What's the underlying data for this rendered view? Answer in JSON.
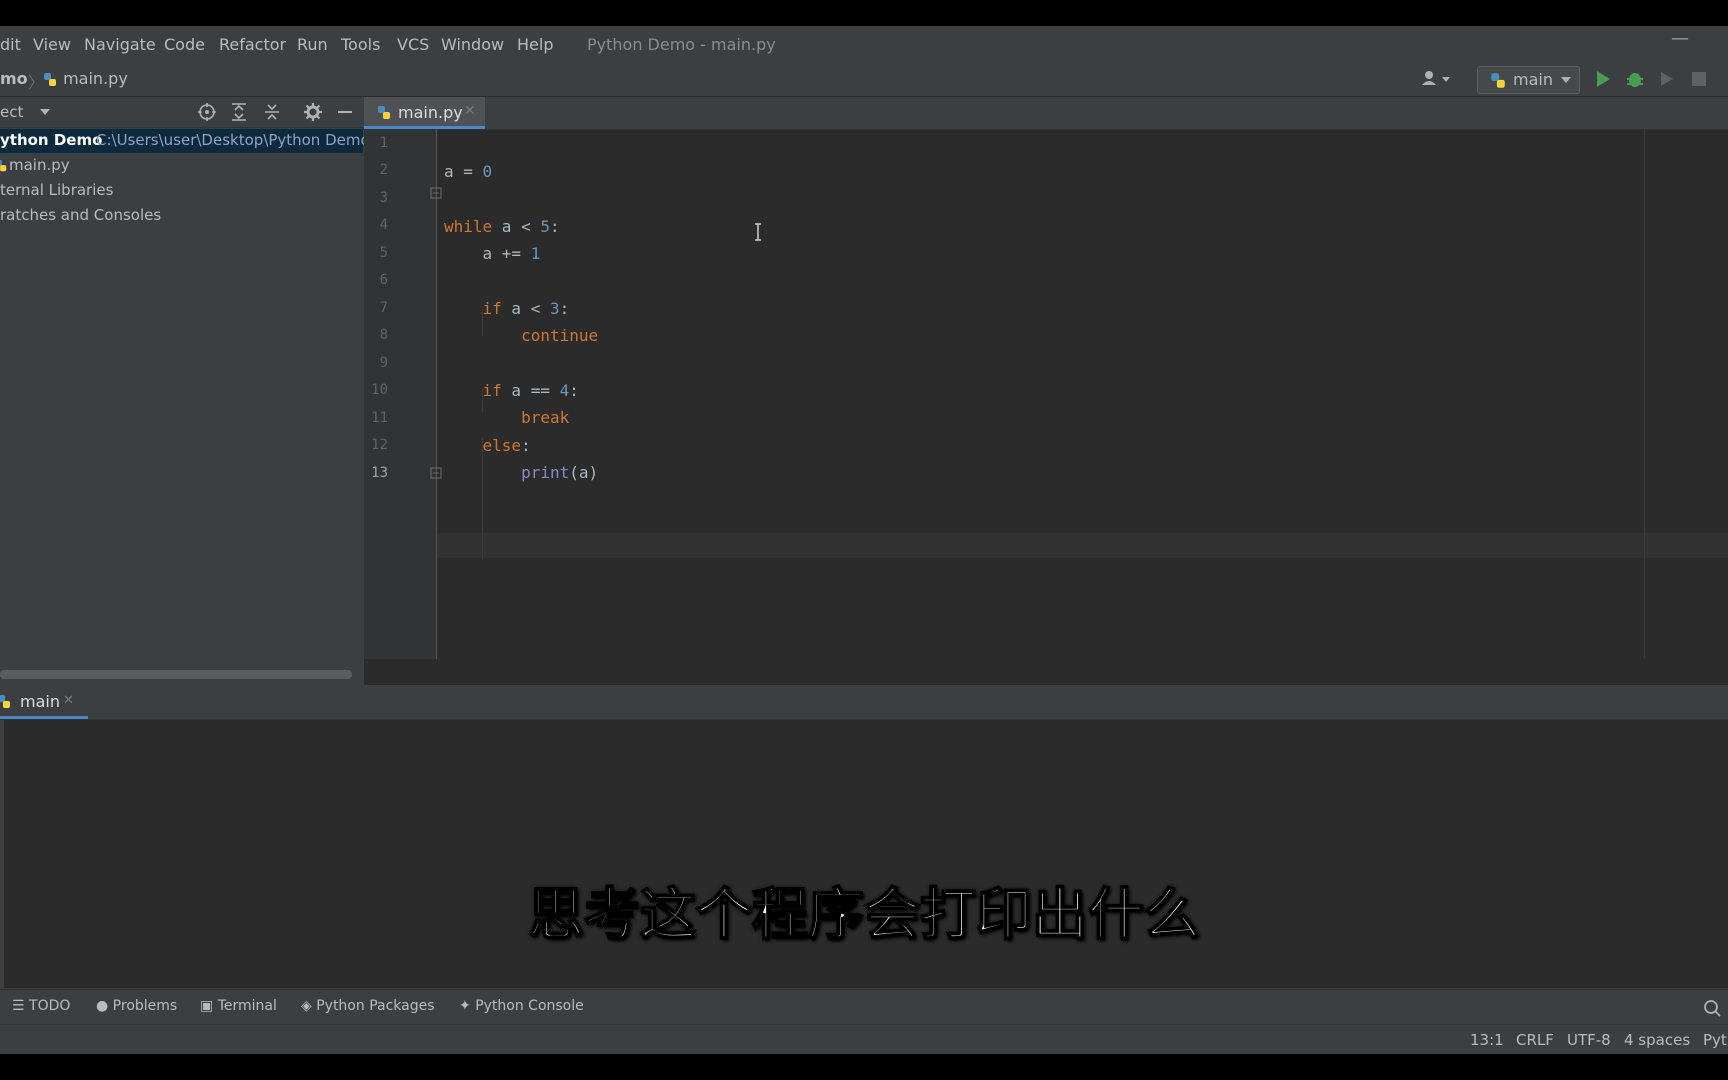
{
  "menubar": {
    "items": [
      "dit",
      "View",
      "Navigate",
      "Code",
      "Refactor",
      "Run",
      "Tools",
      "VCS",
      "Window",
      "Help"
    ],
    "window_title": "Python Demo - main.py"
  },
  "navbar": {
    "project_crumb": "mo",
    "file_crumb": "main.py",
    "run_config": "main"
  },
  "project_panel": {
    "header": "ect",
    "tree": [
      {
        "name": "ython Demo",
        "path": "C:\\Users\\user\\Desktop\\Python Demo"
      },
      {
        "name": "main.py"
      },
      {
        "name": "ternal Libraries"
      },
      {
        "name": "ratches and Consoles"
      }
    ]
  },
  "editor": {
    "tab": "main.py",
    "line_numbers": [
      "1",
      "2",
      "3",
      "4",
      "5",
      "6",
      "7",
      "8",
      "9",
      "10",
      "11",
      "12",
      "13"
    ],
    "code": {
      "l1": {
        "var": "a",
        "op": " = ",
        "num": "0"
      },
      "l3": {
        "kw": "while",
        "rest": " a < ",
        "num": "5",
        "end": ":"
      },
      "l4": {
        "pre": "    a += ",
        "num": "1"
      },
      "l6": {
        "kw": "if",
        "rest": " a < ",
        "num": "3",
        "end": ":"
      },
      "l7": {
        "kw": "continue"
      },
      "l9": {
        "kw": "if",
        "rest": " a == ",
        "num": "4",
        "end": ":"
      },
      "l10": {
        "kw": "break"
      },
      "l11": {
        "kw": "else",
        "end": ":"
      },
      "l12": {
        "fn": "print",
        "rest": "(a)"
      }
    }
  },
  "run_panel": {
    "tab": "main"
  },
  "subtitle": "思考这个程序会打印出什么",
  "toolwindows": [
    "TODO",
    "Problems",
    "Terminal",
    "Python Packages",
    "Python Console"
  ],
  "status": {
    "position": "13:1",
    "line_sep": "CRLF",
    "encoding": "UTF-8",
    "indent": "4 spaces",
    "interpreter": "Pyth"
  }
}
